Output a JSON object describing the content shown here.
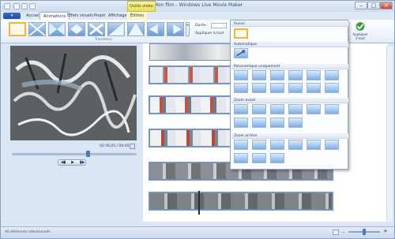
{
  "app": {
    "title": "Mon film - Windows Live Movie Maker",
    "contextual_tab": "Outils vidéo"
  },
  "tabs": [
    "Accueil",
    "Animations",
    "Effets visuels",
    "Projet",
    "Affichage",
    "Édition"
  ],
  "file_button": "▾",
  "ribbon": {
    "duration_label": "Durée :",
    "apply_all_label": "Appliquer à tout",
    "group_label": "Transitions",
    "apply_big_label": "Appliquer à tout"
  },
  "menu": {
    "sections": [
      "Aucun",
      "Automatique",
      "Panoramique uniquement",
      "Zoom avant",
      "Zoom arrière"
    ]
  },
  "preview": {
    "timecode": "02:56,05 / 04:40,00"
  },
  "status": {
    "text": "40 éléments sélectionnés"
  },
  "colors": {
    "accent": "#1f4d99",
    "selection": "#f3b33d"
  }
}
